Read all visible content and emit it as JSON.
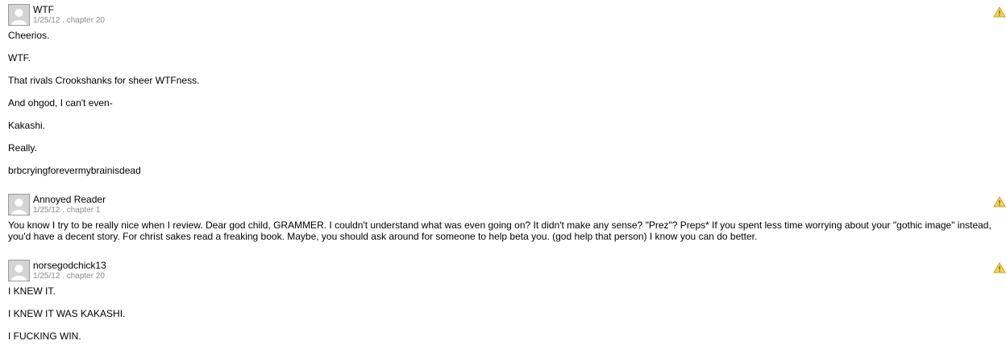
{
  "reviews": [
    {
      "reviewer": "WTF",
      "date": "1/25/12",
      "separator": " . ",
      "chapter": "chapter 20",
      "paragraphs": [
        "Cheerios.",
        "WTF.",
        "That rivals Crookshanks for sheer WTFness.",
        "And ohgod, I can't even-",
        "Kakashi.",
        "Really.",
        "brbcryingforevermybrainisdead"
      ]
    },
    {
      "reviewer": "Annoyed Reader",
      "date": "1/25/12",
      "separator": " . ",
      "chapter": "chapter 1",
      "paragraphs": [
        "You know I try to be really nice when I review. Dear god child, GRAMMER. I couldn't understand what was even going on? It didn't make any sense? \"Prez\"? Preps* If you spent less time worrying about your \"gothic image\" instead, you'd have a decent story. For christ sakes read a freaking book. Maybe, you should ask around for someone to help beta you. (god help that person) I know you can do better."
      ]
    },
    {
      "reviewer": "norsegodchick13",
      "date": "1/25/12",
      "separator": " . ",
      "chapter": "chapter 20",
      "paragraphs": [
        "I KNEW IT.",
        "I KNEW IT WAS KAKASHI.",
        "I FUCKING WIN."
      ]
    }
  ],
  "icons": {
    "avatar": "default-avatar-silhouette",
    "report": "warning-triangle-icon"
  },
  "colors": {
    "meta_text": "#8a8a8a",
    "report_fill": "#f5d35c",
    "report_stroke": "#c9a227",
    "avatar_bg": "#cfcfcf"
  }
}
